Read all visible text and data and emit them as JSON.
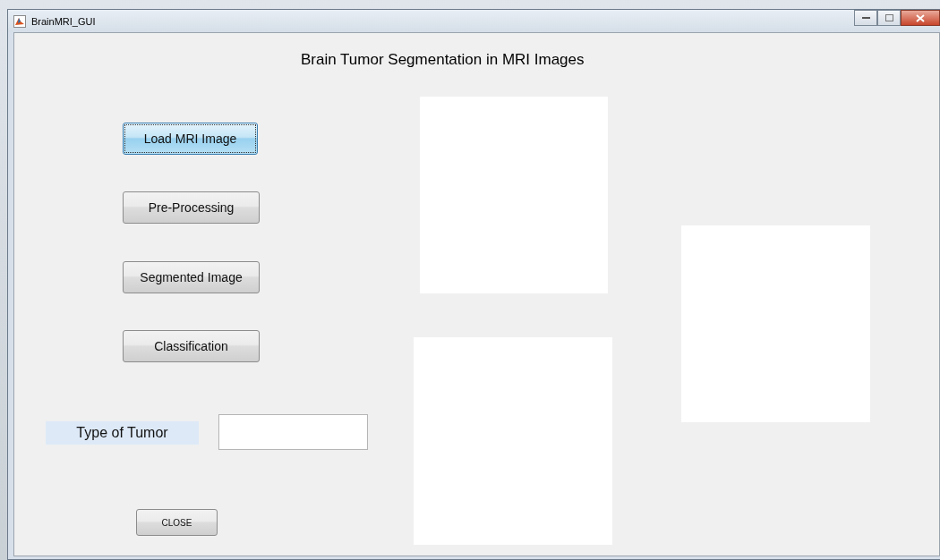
{
  "window": {
    "title": "BrainMRI_GUI"
  },
  "heading": "Brain Tumor Segmentation in MRI Images",
  "buttons": [
    {
      "label": "Load MRI Image",
      "focused": true
    },
    {
      "label": "Pre-Processing",
      "focused": false
    },
    {
      "label": "Segmented Image",
      "focused": false
    },
    {
      "label": "Classification",
      "focused": false
    }
  ],
  "tumor_type": {
    "label": "Type of Tumor"
  },
  "close_button": "CLOSE",
  "image_axes": [
    {
      "kind": "empty"
    },
    {
      "kind": "empty"
    },
    {
      "kind": "empty"
    }
  ]
}
